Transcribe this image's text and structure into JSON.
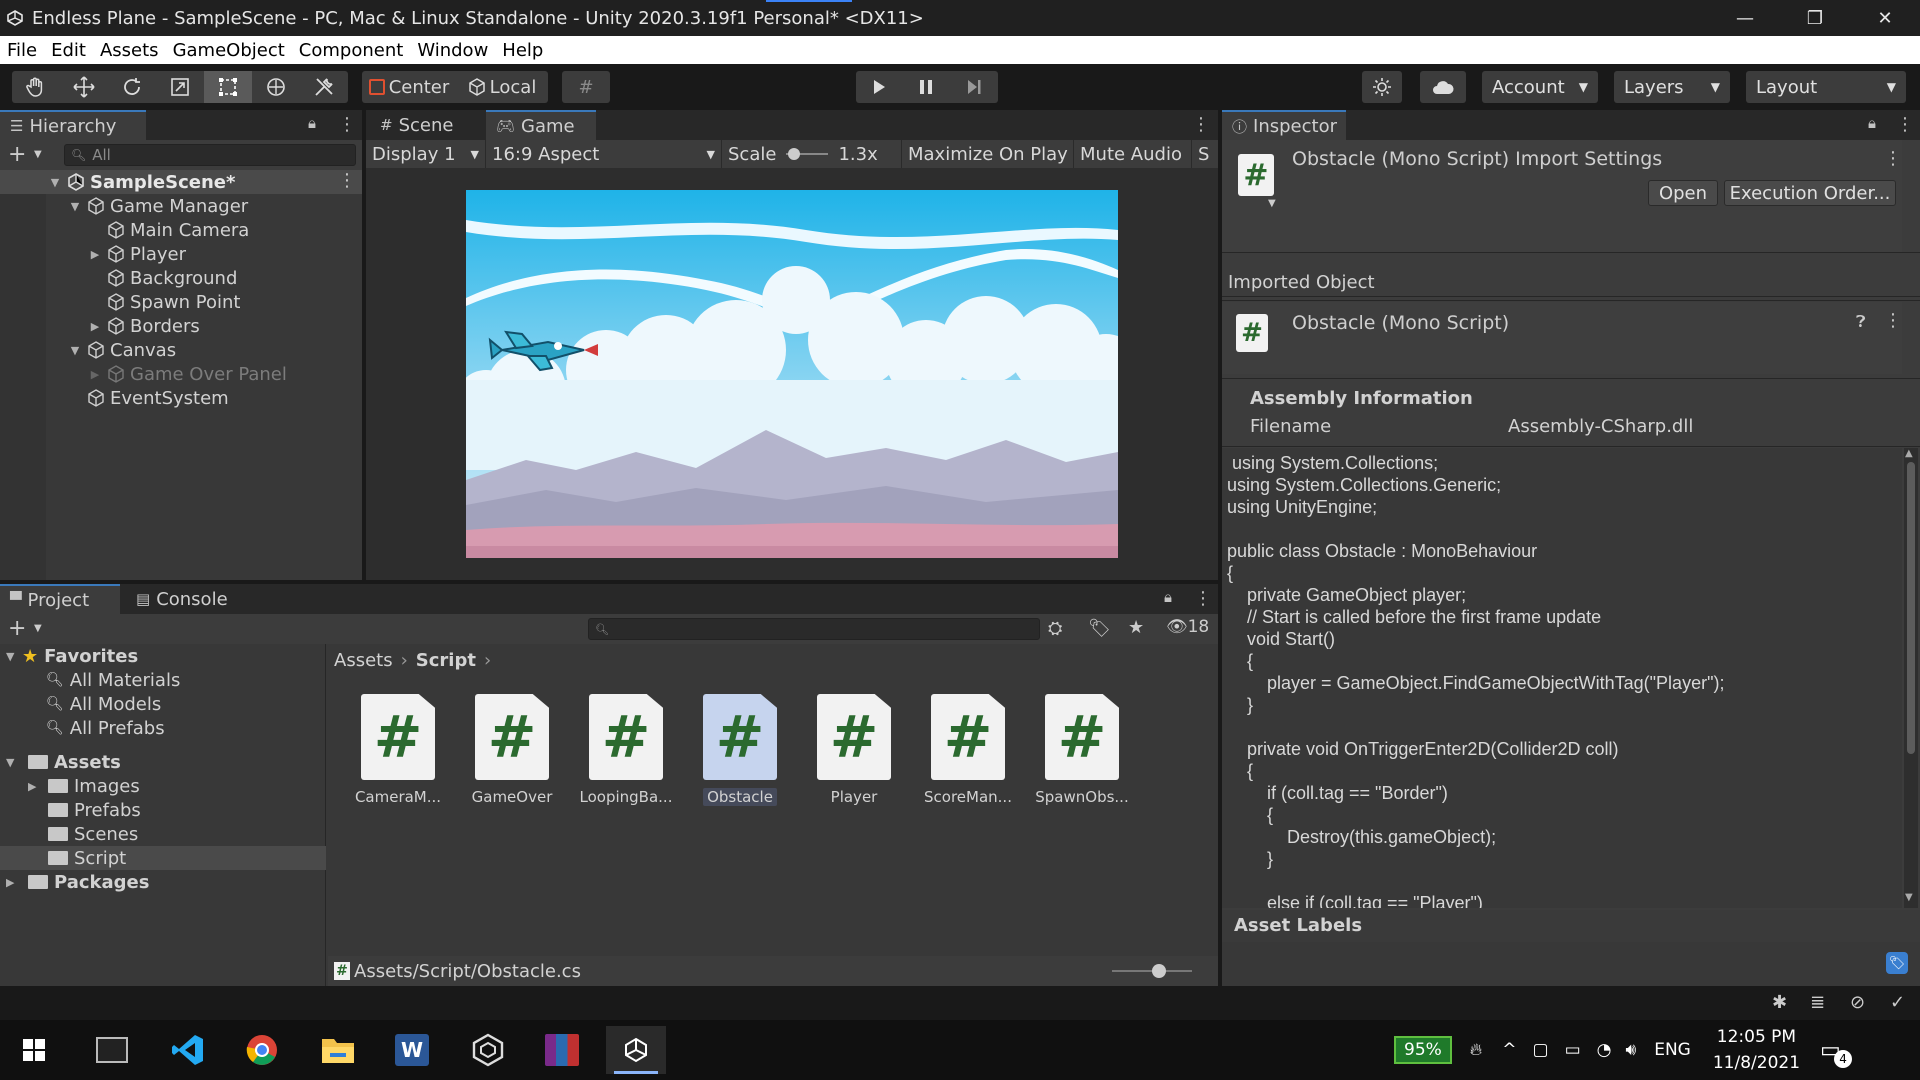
{
  "window": {
    "title": "Endless Plane - SampleScene - PC, Mac & Linux Standalone - Unity 2020.3.19f1 Personal* <DX11>",
    "minimize": "—",
    "maximize": "❐",
    "close": "✕"
  },
  "menu": [
    "File",
    "Edit",
    "Assets",
    "GameObject",
    "Component",
    "Window",
    "Help"
  ],
  "toolbar": {
    "pivot": "Center",
    "space": "Local",
    "account": "Account",
    "layers": "Layers",
    "layout": "Layout"
  },
  "hierarchy": {
    "tab": "Hierarchy",
    "search_placeholder": "All",
    "scene": "SampleScene*",
    "items": [
      {
        "label": "Game Manager"
      },
      {
        "label": "Main Camera"
      },
      {
        "label": "Player"
      },
      {
        "label": "Background"
      },
      {
        "label": "Spawn Point"
      },
      {
        "label": "Borders"
      },
      {
        "label": "Canvas"
      },
      {
        "label": "Game Over Panel"
      },
      {
        "label": "EventSystem"
      }
    ]
  },
  "game_view": {
    "tab_scene": "Scene",
    "tab_game": "Game",
    "display": "Display 1",
    "aspect": "16:9 Aspect",
    "scale_label": "Scale",
    "scale_value": "1.3x",
    "maximize": "Maximize On Play",
    "mute": "Mute Audio",
    "stats": "S"
  },
  "project": {
    "tab_project": "Project",
    "tab_console": "Console",
    "hidden_count": "18",
    "favorites": "Favorites",
    "favorites_items": [
      "All Materials",
      "All Models",
      "All Prefabs"
    ],
    "assets": "Assets",
    "assets_items": [
      "Images",
      "Prefabs",
      "Scenes",
      "Script"
    ],
    "packages": "Packages",
    "breadcrumb": [
      "Assets",
      "Script"
    ],
    "files": [
      "CameraM...",
      "GameOver",
      "LoopingBa...",
      "Obstacle",
      "Player",
      "ScoreMan...",
      "SpawnObs..."
    ],
    "selected_file": "Obstacle",
    "footer_path": "Assets/Script/Obstacle.cs"
  },
  "inspector": {
    "tab": "Inspector",
    "header_title": "Obstacle (Mono Script) Import Settings",
    "open": "Open",
    "execution_order": "Execution Order...",
    "imported_object": "Imported Object",
    "object_title": "Obstacle (Mono Script)",
    "assembly_info": "Assembly Information",
    "filename_label": "Filename",
    "filename_value": "Assembly-CSharp.dll",
    "code": " using System.Collections;\nusing System.Collections.Generic;\nusing UnityEngine;\n\npublic class Obstacle : MonoBehaviour\n{\n    private GameObject player;\n    // Start is called before the first frame update\n    void Start()\n    {\n        player = GameObject.FindGameObjectWithTag(\"Player\");\n    }\n\n    private void OnTriggerEnter2D(Collider2D coll)\n    {\n        if (coll.tag == \"Border\")\n        {\n            Destroy(this.gameObject);\n        }\n\n        else if (coll.tag == \"Player\")",
    "asset_labels": "Asset Labels"
  },
  "taskbar": {
    "battery": "95%",
    "language": "ENG",
    "time": "12:05 PM",
    "date": "11/8/2021",
    "notifications": "4"
  }
}
